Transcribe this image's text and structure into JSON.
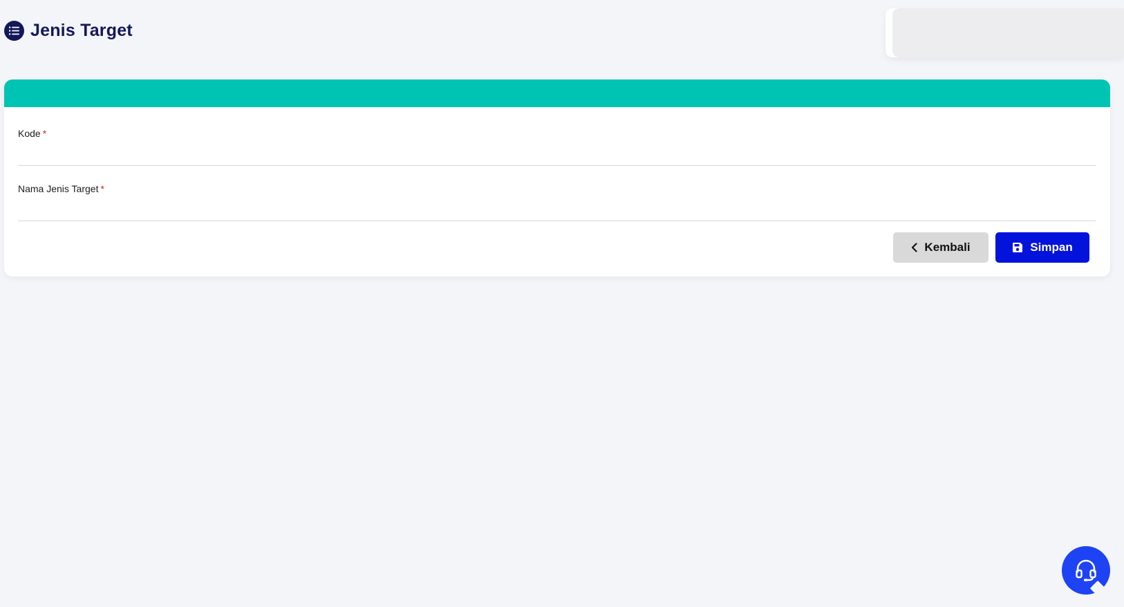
{
  "page": {
    "title": "Jenis Target",
    "title_icon": "list-icon"
  },
  "form": {
    "fields": [
      {
        "label": "Kode",
        "required_mark": "*",
        "value": ""
      },
      {
        "label": "Nama Jenis Target",
        "required_mark": "*",
        "value": ""
      }
    ],
    "buttons": {
      "back_label": "Kembali",
      "back_icon": "chevron-left-icon",
      "save_label": "Simpan",
      "save_icon": "floppy-disk-icon"
    }
  },
  "support": {
    "icon": "headset-icon"
  },
  "colors": {
    "accent_header": "#00c4b3",
    "title_color": "#13185a",
    "save_button": "#0413db",
    "back_button": "#d9d9d9",
    "fab": "#1e43f5",
    "required": "#e01b1b"
  }
}
